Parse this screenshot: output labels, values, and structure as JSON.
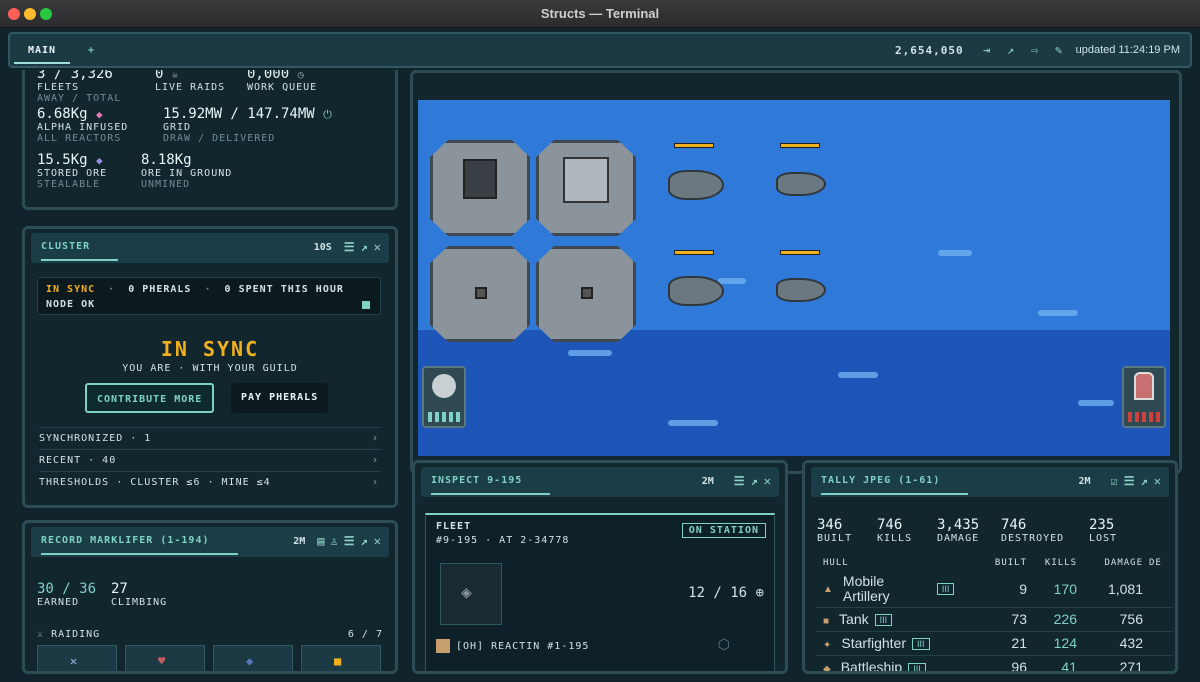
{
  "window": {
    "title": "Structs — Terminal"
  },
  "topbar": {
    "tabs": [
      {
        "label": "MAIN"
      },
      {
        "label": "+"
      }
    ],
    "balance": "2,654,050",
    "updated": "updated 11:24:19 PM"
  },
  "stats": {
    "fleets_value": "3 / 3,326",
    "fleets_label": "FLEETS",
    "fleets_sub": "AWAY / TOTAL",
    "raids_value": "0",
    "raids_label": "LIVE RAIDS",
    "queue_value": "0,000",
    "queue_label": "WORK QUEUE",
    "alpha_value": "6.68Kg",
    "alpha_label": "ALPHA INFUSED",
    "alpha_sub": "ALL REACTORS",
    "grid_value": "15.92MW / 147.74MW",
    "grid_label": "GRID",
    "grid_sub": "DRAW / DELIVERED",
    "stored_value": "15.5Kg",
    "stored_label": "STORED ORE",
    "stored_sub": "STEALABLE",
    "ground_value": "8.18Kg",
    "ground_label": "ORE IN GROUND",
    "ground_sub": "UNMINED"
  },
  "cluster": {
    "title": "CLUSTER",
    "time": "10S",
    "status_items": [
      "IN SYNC",
      "0 PHERALS",
      "0 SPENT THIS HOUR"
    ],
    "node": "NODE OK",
    "headline": "IN SYNC",
    "subline": "YOU ARE · WITH YOUR GUILD",
    "contribute_label": "CONTRIBUTE MORE",
    "pay_label": "PAY PHERALS",
    "rows": [
      {
        "label": "SYNCHRONIZED · 1"
      },
      {
        "label": "RECENT · 40"
      },
      {
        "label": "THRESHOLDS · CLUSTER ≤6 · MINE ≤4"
      }
    ]
  },
  "record": {
    "title": "RECORD MARKLIFER (1-194)",
    "time": "2M",
    "earned_value": "30 / 36",
    "earned_label": "EARNED",
    "climbing_value": "27",
    "climbing_label": "CLIMBING",
    "raiding_label": "RAIDING",
    "raiding_count": "6 / 7"
  },
  "inspect": {
    "title": "INSPECT 9-195",
    "time": "2M",
    "fleet_label": "FLEET",
    "fleet_id": "#9-195 · AT 2-34778",
    "status": "ON STATION",
    "count": "12 / 16",
    "member": "[OH] REACTIN #1-195"
  },
  "tally": {
    "title": "TALLY JPEG (1-61)",
    "time": "2M",
    "summary": [
      {
        "value": "346",
        "label": "BUILT"
      },
      {
        "value": "746",
        "label": "KILLS"
      },
      {
        "value": "3,435",
        "label": "DAMAGE"
      },
      {
        "value": "746",
        "label": "DESTROYED"
      },
      {
        "value": "235",
        "label": "LOST"
      }
    ],
    "headers": {
      "hull": "HULL",
      "built": "BUILT",
      "kills": "KILLS",
      "damage": "DAMAGE",
      "de": "DE"
    },
    "rows": [
      {
        "name": "Mobile Artillery",
        "mark": "III",
        "built": "9",
        "kills": "170",
        "damage": "1,081"
      },
      {
        "name": "Tank",
        "mark": "III",
        "built": "73",
        "kills": "226",
        "damage": "756"
      },
      {
        "name": "Starfighter",
        "mark": "III",
        "built": "21",
        "kills": "124",
        "damage": "432"
      },
      {
        "name": "Battleship",
        "mark": "III",
        "built": "96",
        "kills": "41",
        "damage": "271"
      }
    ]
  },
  "colors": {
    "accent": "#7fd1c4",
    "gold": "#f0b020",
    "ocean": "#2f79d9"
  }
}
